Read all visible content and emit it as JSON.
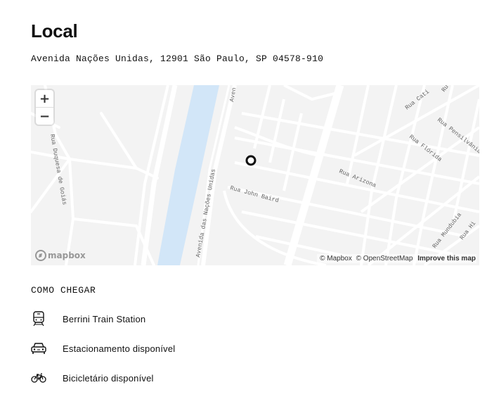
{
  "page": {
    "title": "Local",
    "address": "Avenida Nações Unidas, 12901 São Paulo, SP 04578-910"
  },
  "map": {
    "zoom_in_label": "+",
    "zoom_out_label": "−",
    "logo_text": "mapbox",
    "attribution": {
      "mapbox": "© Mapbox",
      "osm": "© OpenStreetMap",
      "improve": "Improve this map"
    },
    "street_labels": {
      "duquesa": "Rua Duquesa de Goiás",
      "nacoes": "Avenida das Nações Unidas",
      "nacoes_top": "Aven",
      "john_baird": "Rua John Baird",
      "arizona": "Rua Arizona",
      "florida": "Rua Flórida",
      "pensilvania": "Rua Pensilvânia",
      "cati": "Rua Cati",
      "mundubia": "Rua Mundubia",
      "hi": "Rua Hi",
      "ru": "Ru"
    },
    "colors": {
      "land": "#f3f3f3",
      "roads": "#ffffff",
      "river": "#d2e6f8",
      "marker": "#111111"
    }
  },
  "directions": {
    "heading": "COMO CHEGAR",
    "items": [
      {
        "icon": "train-icon",
        "label": "Berrini Train Station"
      },
      {
        "icon": "car-icon",
        "label": "Estacionamento disponível"
      },
      {
        "icon": "bicycle-icon",
        "label": "Bicicletário disponível"
      }
    ]
  }
}
